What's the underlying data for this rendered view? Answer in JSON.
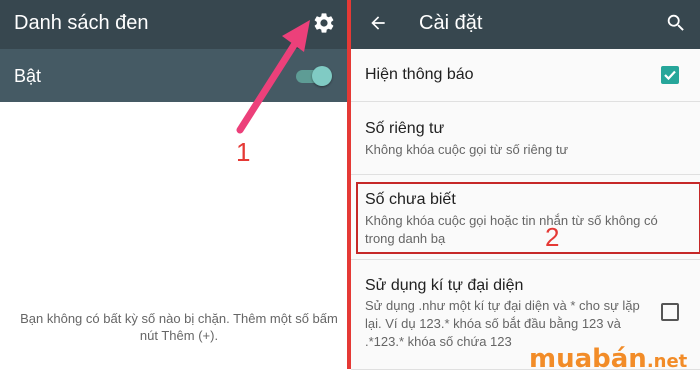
{
  "left": {
    "title": "Danh sách đen",
    "toggle_label": "Bật",
    "toggle_on": true,
    "empty_message": "Bạn không có bất kỳ số nào bị chặn. Thêm một số bấm nút Thêm (+).",
    "annotation_number": "1"
  },
  "right": {
    "title": "Cài đặt",
    "items": [
      {
        "title": "Hiện thông báo",
        "checked": true
      },
      {
        "title": "Số riêng tư",
        "subtitle": "Không khóa cuộc gọi từ số riêng tư"
      },
      {
        "title": "Số chưa biết",
        "subtitle": "Không khóa cuộc gọi hoặc tin nhắn từ số không có trong danh bạ"
      },
      {
        "title": "Sử dụng kí tự đại diện",
        "subtitle": "Sử dụng .như một kí tự đại diện và * cho sự lặp lại. Ví dụ 123.* khóa số bắt đầu bằng 123 và .*123.* khóa số chứa 123",
        "checked": false
      }
    ],
    "annotation_number": "2"
  },
  "watermark": {
    "main": "muabán",
    "suffix": ".net"
  },
  "colors": {
    "header": "#37474f",
    "toggle_row": "#455a64",
    "accent": "#26a69a",
    "annotation": "#e53935",
    "brand": "#f28c28"
  },
  "icons": {
    "left_header": "gear-icon",
    "right_back": "back-arrow-icon",
    "right_search": "search-icon"
  }
}
